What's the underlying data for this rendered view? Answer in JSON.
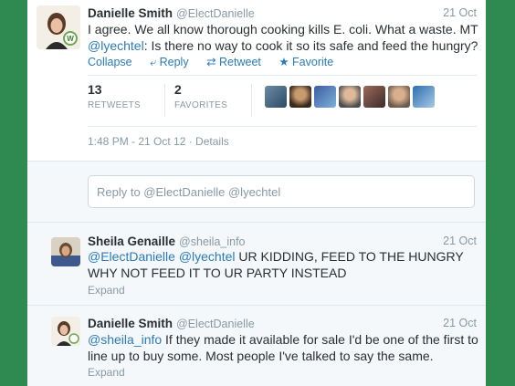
{
  "main_tweet": {
    "name": "Danielle Smith",
    "handle": "@ElectDanielle",
    "date": "21 Oct",
    "text_before": "I agree. We all know thorough cooking kills E. coli. What a waste. MT ",
    "mention": "@lyechtel",
    "text_after": ": Is there no way to cook it so its safe and feed the hungry?",
    "actions": {
      "collapse": "Collapse",
      "reply": "Reply",
      "retweet": "Retweet",
      "favorite": "Favorite"
    },
    "icons": {
      "reply": "reply-arrow-icon",
      "retweet": "retweet-icon",
      "favorite": "star-icon"
    },
    "retweets_count": "13",
    "retweets_label": "RETWEETS",
    "favorites_count": "2",
    "favorites_label": "FAVORITES",
    "meta": "1:48 PM - 21 Oct 12 · Details"
  },
  "reply_box": {
    "placeholder": "Reply to @ElectDanielle @lyechtel"
  },
  "replies": [
    {
      "name": "Sheila Genaille",
      "handle": "@sheila_info",
      "date": "21 Oct",
      "mention1": "@ElectDanielle",
      "mention2": "@lyechtel",
      "text": " UR KIDDING, FEED TO THE HUNGRY WHY NOT FEED IT TO UR PARTY INSTEAD",
      "expand": "Expand"
    },
    {
      "name": "Danielle Smith",
      "handle": "@ElectDanielle",
      "date": "21 Oct",
      "mention1": "@sheila_info",
      "text": " If they made it available for sale I'd be one of the first to line up to buy some. Most people I've talked to say the same.",
      "expand": "Expand"
    }
  ],
  "colors": {
    "link": "#2b7bb9",
    "frame": "#2f8a52",
    "muted": "#8899a6"
  }
}
